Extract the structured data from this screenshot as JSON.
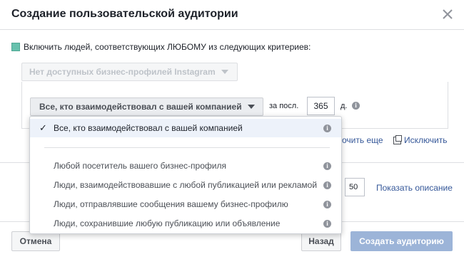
{
  "dialog": {
    "title": "Создание пользовательской аудитории"
  },
  "include": {
    "label": "Включить людей, соответствующих ЛЮБОМУ из следующих критериев:"
  },
  "instagram_select": {
    "label": "Нет доступных бизнес-профилей Instagram"
  },
  "rule": {
    "who_label": "Все, кто взаимодействовал с вашей компанией",
    "period_prefix": "за посл.",
    "days_value": "365",
    "days_suffix": "д."
  },
  "links": {
    "more": "очить еще",
    "exclude": "Исключить",
    "description": "Показать описание"
  },
  "name_field": {
    "value": "50"
  },
  "dropdown": {
    "selected": "Все, кто взаимодействовал с вашей компанией",
    "items": [
      "Любой посетитель вашего бизнес-профиля",
      "Люди, взаимодействовавшие с любой публикацией или рекламой",
      "Люди, отправлявшие сообщения вашему бизнес-профилю",
      "Люди, сохранившие любую публикацию или объявление"
    ]
  },
  "footer": {
    "cancel": "Отмена",
    "back": "Назад",
    "create": "Создать аудиторию"
  },
  "icons": {
    "close": "close-icon",
    "info": "info-icon",
    "check": "checkmark-icon",
    "exclude": "exclude-icon"
  },
  "colors": {
    "link": "#365899",
    "primary_disabled": "#9cb4d8",
    "include_check": "#67c1ad",
    "selected_row": "#edf2fa"
  }
}
